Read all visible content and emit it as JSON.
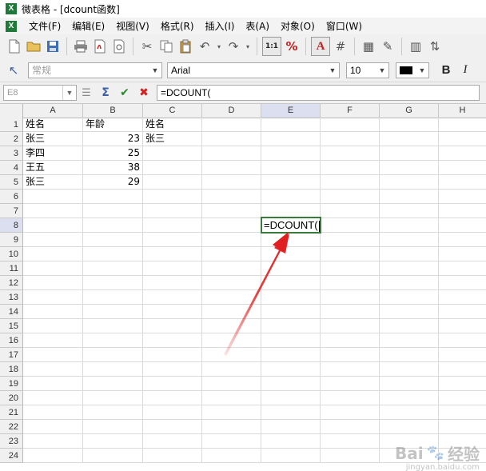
{
  "window": {
    "title": "微表格 - [dcount函数]"
  },
  "menu": [
    "文件(F)",
    "编辑(E)",
    "视图(V)",
    "格式(R)",
    "插入(I)",
    "表(A)",
    "对象(O)",
    "窗口(W)"
  ],
  "toolbar": {
    "style_combo": "常规",
    "font_combo": "Arial",
    "size_combo": "10"
  },
  "formula_bar": {
    "name_box": "E8",
    "formula": "=DCOUNT("
  },
  "sheet": {
    "columns": [
      "A",
      "B",
      "C",
      "D",
      "E",
      "F",
      "G",
      "H"
    ],
    "rows": [
      "1",
      "2",
      "3",
      "4",
      "5",
      "6",
      "7",
      "8",
      "9",
      "10",
      "11",
      "12",
      "13",
      "14",
      "15",
      "16",
      "17",
      "18",
      "19",
      "20",
      "21",
      "22",
      "23",
      "24"
    ],
    "cells": {
      "A1": "姓名",
      "B1": "年龄",
      "C1": "姓名",
      "A2": "张三",
      "B2": "23",
      "C2": "张三",
      "A3": "李四",
      "B3": "25",
      "A4": "王五",
      "B4": "38",
      "A5": "张三",
      "B5": "29",
      "E8": "=DCOUNT("
    },
    "active_cell": "E8"
  },
  "colors": {
    "arrow": "#e02020",
    "selection_border": "#3a7a3a",
    "header_highlight": "#dcdff0"
  },
  "watermark": {
    "text": "Bai",
    "suffix": "经验",
    "sub": "jingyan.baidu.com"
  }
}
